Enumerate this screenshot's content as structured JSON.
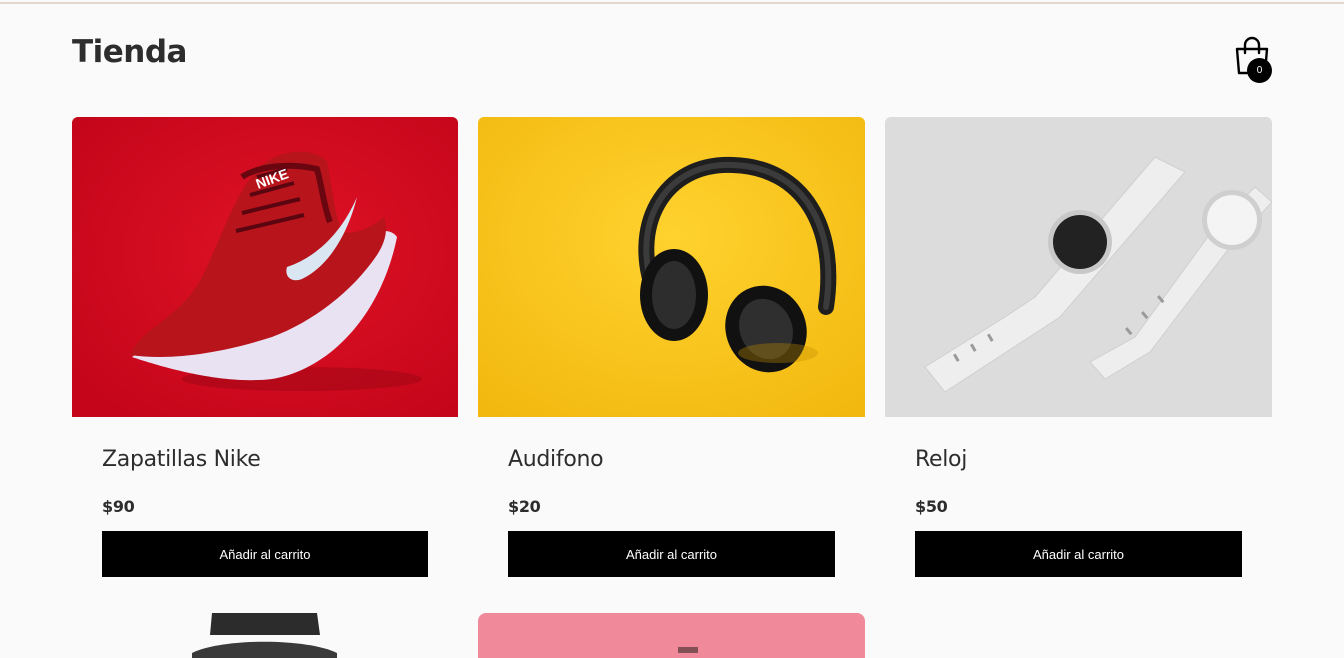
{
  "header": {
    "title": "Tienda",
    "cart_icon": "shopping-bag-icon",
    "cart_count": "0"
  },
  "products": [
    {
      "name": "Zapatillas Nike",
      "price": "$90",
      "button": "Añadir al carrito",
      "image": "red-nike-sneaker-photo"
    },
    {
      "name": "Audifono",
      "price": "$20",
      "button": "Añadir al carrito",
      "image": "black-headphones-yellow-photo"
    },
    {
      "name": "Reloj",
      "price": "$50",
      "button": "Añadir al carrito",
      "image": "white-watches-photo"
    },
    {
      "image": "black-watch-photo"
    },
    {
      "image": "pink-background-photo"
    }
  ],
  "colors": {
    "background": "#fafafa",
    "button": "#000000",
    "button_text": "#ffffff",
    "nike_bg": "#d7091f",
    "headphones_bg": "#f6c11a",
    "watch_bg": "#dcdcdc",
    "pink_bg": "#f08a9a"
  }
}
